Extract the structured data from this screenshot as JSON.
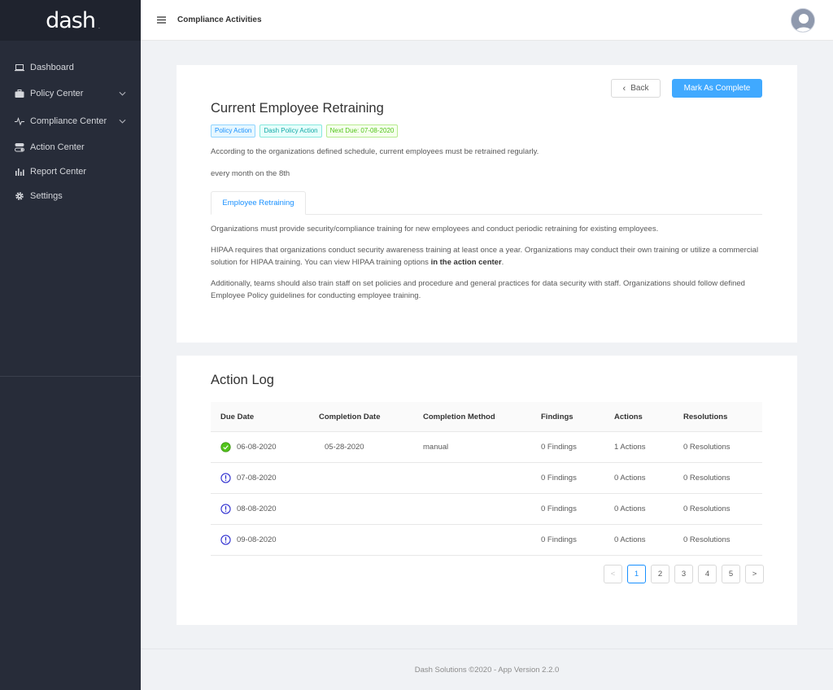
{
  "brand": {
    "logo_text": "dash",
    "logo_mark": "."
  },
  "sidebar": {
    "items": [
      {
        "label": "Dashboard",
        "icon": "laptop-icon"
      },
      {
        "label": "Policy Center",
        "icon": "briefcase-icon",
        "expandable": true
      },
      {
        "label": "Compliance Center",
        "icon": "pulse-icon",
        "expandable": true
      },
      {
        "label": "Action Center",
        "icon": "toggles-icon"
      },
      {
        "label": "Report Center",
        "icon": "bar-chart-icon"
      },
      {
        "label": "Settings",
        "icon": "gear-icon"
      }
    ]
  },
  "header": {
    "title": "Compliance Activities"
  },
  "activity": {
    "back_label": "Back",
    "complete_label": "Mark As Complete",
    "title": "Current Employee Retraining",
    "tags": [
      "Policy Action",
      "Dash Policy Action",
      "Next Due: 07-08-2020"
    ],
    "description": "According to the organizations defined schedule, current employees must be retrained regularly.",
    "schedule": "every month on the 8th",
    "tab_label": "Employee Retraining",
    "paragraph1": "Organizations must provide security/compliance training for new employees and conduct periodic retraining for existing employees.",
    "paragraph2_text": "HIPAA requires that organizations conduct security awareness training at least once a year. Organizations may conduct their own training or utilize a commercial solution for HIPAA training. You can view HIPAA training options ",
    "paragraph2_link": "in the action center",
    "paragraph2_end": ".",
    "paragraph3": "Additionally, teams should also train staff on set policies and procedure and general practices for data security with staff. Organizations should follow defined Employee Policy guidelines for conducting employee training."
  },
  "action_log": {
    "title": "Action Log",
    "columns": [
      "Due Date",
      "Completion Date",
      "Completion Method",
      "Findings",
      "Actions",
      "Resolutions"
    ],
    "rows": [
      {
        "status": "completed",
        "due_date": "06-08-2020",
        "completion_date": "05-28-2020",
        "method": "manual",
        "findings": "0 Findings",
        "actions": "1 Actions",
        "resolutions": "0 Resolutions"
      },
      {
        "status": "pending",
        "due_date": "07-08-2020",
        "completion_date": "",
        "method": "",
        "findings": "0 Findings",
        "actions": "0 Actions",
        "resolutions": "0 Resolutions"
      },
      {
        "status": "pending",
        "due_date": "08-08-2020",
        "completion_date": "",
        "method": "",
        "findings": "0 Findings",
        "actions": "0 Actions",
        "resolutions": "0 Resolutions"
      },
      {
        "status": "pending",
        "due_date": "09-08-2020",
        "completion_date": "",
        "method": "",
        "findings": "0 Findings",
        "actions": "0 Actions",
        "resolutions": "0 Resolutions"
      }
    ],
    "pagination": {
      "prev": "<",
      "pages": [
        "1",
        "2",
        "3",
        "4",
        "5"
      ],
      "current": "1",
      "next": ">"
    }
  },
  "footer": {
    "text": "Dash Solutions ©2020 - App Version 2.2.0"
  },
  "colors": {
    "sidebar_bg": "#272c39",
    "primary": "#40a9ff",
    "success": "#52c41a",
    "pending": "#2f2fd0"
  }
}
